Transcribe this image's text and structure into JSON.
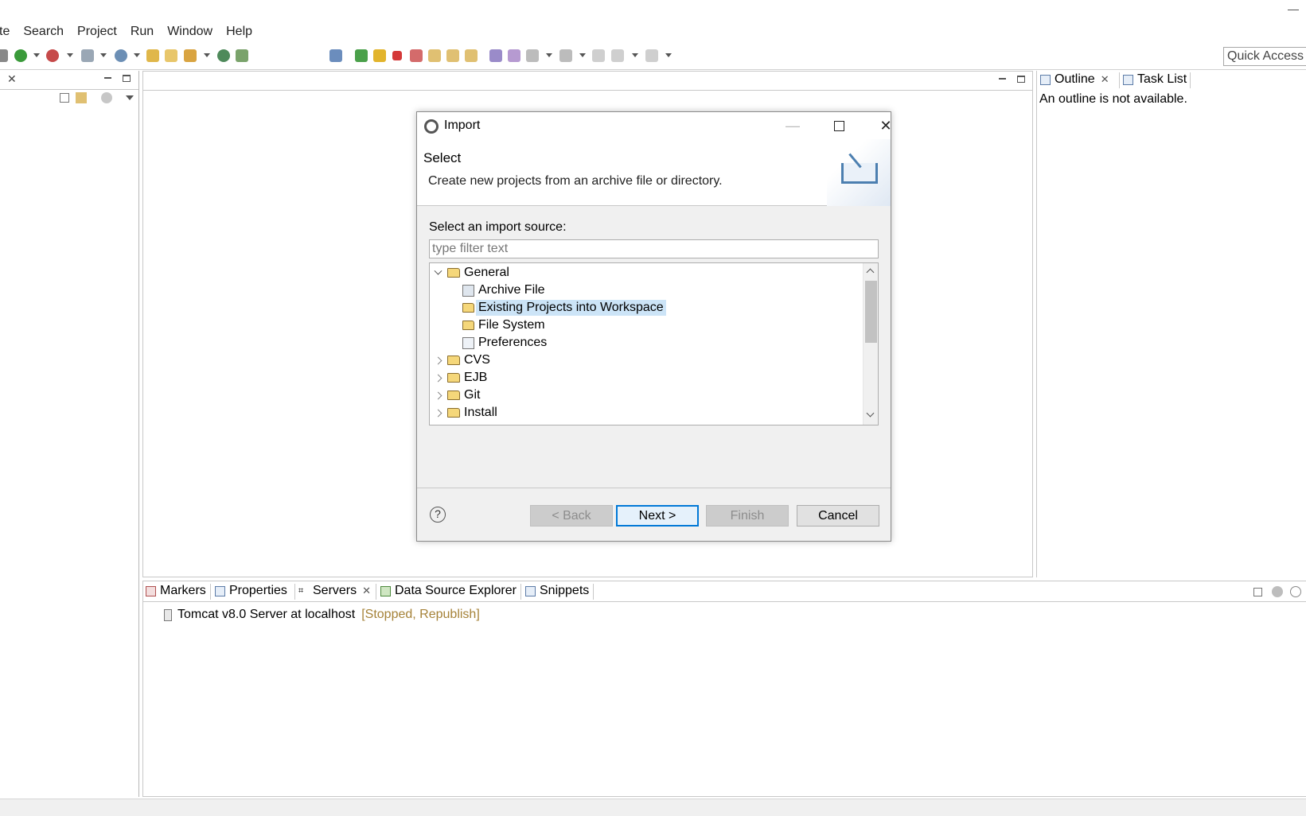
{
  "menu": [
    "te",
    "Search",
    "Project",
    "Run",
    "Window",
    "Help"
  ],
  "quick_access": "Quick Access",
  "outline": {
    "tabs": [
      {
        "label": "Outline"
      },
      {
        "label": "Task List"
      }
    ],
    "message": "An outline is not available."
  },
  "bottom": {
    "tabs": [
      {
        "label": "Markers"
      },
      {
        "label": "Properties"
      },
      {
        "label": "Servers"
      },
      {
        "label": "Data Source Explorer"
      },
      {
        "label": "Snippets"
      }
    ],
    "server": {
      "name": "Tomcat v8.0 Server at localhost",
      "status": "[Stopped, Republish]"
    }
  },
  "dialog": {
    "title": "Import",
    "heading": "Select",
    "description": "Create new projects from an archive file or directory.",
    "source_label": "Select an import source:",
    "filter_placeholder": "type filter text",
    "tree": [
      {
        "label": "General",
        "expanded": true
      },
      {
        "label": "Archive File"
      },
      {
        "label": "Existing Projects into Workspace",
        "selected": true
      },
      {
        "label": "File System"
      },
      {
        "label": "Preferences"
      },
      {
        "label": "CVS"
      },
      {
        "label": "EJB"
      },
      {
        "label": "Git"
      },
      {
        "label": "Install"
      }
    ],
    "buttons": {
      "back": "< Back",
      "next": "Next >",
      "finish": "Finish",
      "cancel": "Cancel"
    },
    "help": "?"
  },
  "colors": {
    "selection": "#cce4f7",
    "accent": "#0078d7",
    "status_text": "#a58238"
  }
}
